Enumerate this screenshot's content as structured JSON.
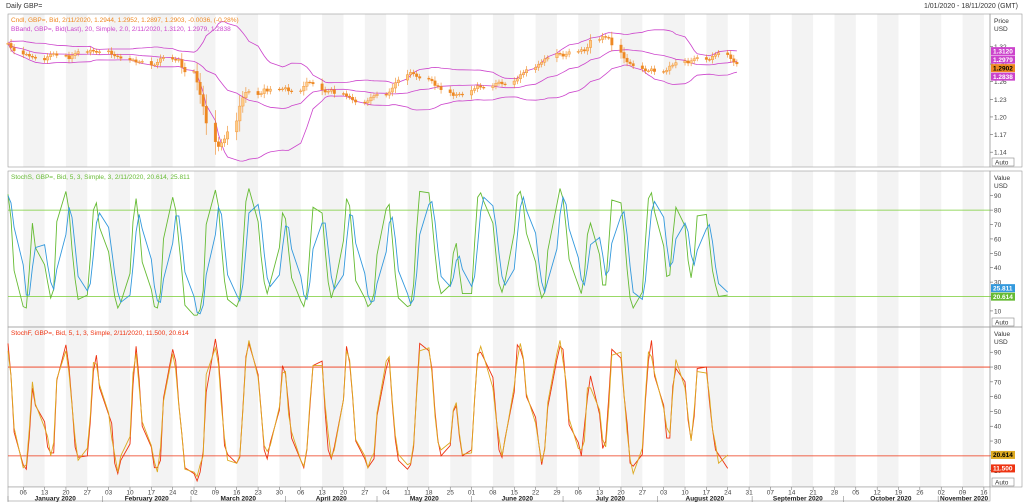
{
  "header": {
    "title": "Daily GBP=",
    "range": "1/01/2020 - 18/11/2020 (GMT)"
  },
  "colors": {
    "candle_up": "#ffcc88",
    "candle_down": "#ee8822",
    "bband": "#cc44cc",
    "stochs_k": "#66bb33",
    "stochs_d": "#3399dd",
    "stochf_k": "#ee3311",
    "stochf_d": "#ddaa22",
    "band_lines_mid": "#77cc33",
    "band_lines_bottom": "#ee3311",
    "shade": "#f3f3f3"
  },
  "panels": {
    "price": {
      "legend": [
        {
          "text": "Cndl, GBP=, Bid, 2/11/2020, 1.2944, 1.2952, 1.2897, 1.2903, -0.0036, (-0.28%)",
          "color": "#ee8822"
        },
        {
          "text": "BBand, GBP=, Bid(Last), 20, Simple, 2.0, 2/11/2020, 1.3120, 1.2979, 1.2838",
          "color": "#cc44cc"
        }
      ],
      "axis_title": [
        "Price",
        "USD"
      ],
      "auto_label": "Auto",
      "tags": [
        {
          "text": "1.3120",
          "bg": "#cc44cc",
          "fg": "#ffffff",
          "value": 1.312
        },
        {
          "text": "1.2979",
          "bg": "#cc44cc",
          "fg": "#ffffff",
          "value": 1.2979
        },
        {
          "text": "1.2902",
          "bg": "#ee8822",
          "fg": "#000000",
          "value": 1.2902
        },
        {
          "text": "1.2838",
          "bg": "#cc44cc",
          "fg": "#ffffff",
          "value": 1.2838
        }
      ]
    },
    "stochs": {
      "legend": [
        {
          "text": "StochS, GBP=, Bid, 5, 3, Simple, 3, 2/11/2020, 20.614, 25.811",
          "color": "#66bb33"
        }
      ],
      "legend_value2_color": "#3399dd",
      "axis_title": [
        "Value",
        "USD"
      ],
      "auto_label": "Auto",
      "tags": [
        {
          "text": "25.811",
          "bg": "#3399dd",
          "fg": "#ffffff",
          "value": 25.811
        },
        {
          "text": "20.614",
          "bg": "#66bb33",
          "fg": "#ffffff",
          "value": 20.614
        }
      ]
    },
    "stochf": {
      "legend": [
        {
          "text": "StochF, GBP=, Bid, 5, 1, 3, Simple, 2/11/2020, 11.500, 20.614",
          "color": "#ee3311"
        }
      ],
      "axis_title": [
        "Value",
        "USD"
      ],
      "auto_label": "Auto",
      "tags": [
        {
          "text": "20.614",
          "bg": "#ddaa22",
          "fg": "#000000",
          "value": 20.614
        },
        {
          "text": "11.500",
          "bg": "#ee3311",
          "fg": "#ffffff",
          "value": 11.5
        }
      ]
    }
  },
  "x_axis": {
    "months": [
      "January 2020",
      "February 2020",
      "March 2020",
      "April 2020",
      "May 2020",
      "June 2020",
      "July 2020",
      "August 2020",
      "September 2020",
      "October 2020",
      "November 2020"
    ],
    "days": [
      "06",
      "13",
      "20",
      "27",
      "03",
      "10",
      "17",
      "24",
      "02",
      "09",
      "16",
      "23",
      "30",
      "06",
      "13",
      "20",
      "27",
      "04",
      "11",
      "18",
      "25",
      "01",
      "08",
      "15",
      "22",
      "29",
      "06",
      "13",
      "20",
      "27",
      "03",
      "10",
      "17",
      "24",
      "31",
      "07",
      "14",
      "21",
      "28",
      "05",
      "12",
      "19",
      "26",
      "02",
      "09",
      "16"
    ]
  },
  "chart_data": [
    {
      "type": "candlestick",
      "title": "Cndl, GBP=, Bid",
      "ylabel": "Price USD",
      "ylim": [
        1.125,
        1.365
      ],
      "yticks": [
        1.14,
        1.17,
        1.2,
        1.23,
        1.26,
        1.29,
        1.32
      ],
      "x_start": "2020-01-01",
      "x_end": "2020-11-18",
      "close": [
        1.3252,
        1.3179,
        1.3128,
        1.3068,
        1.3068,
        1.3034,
        1.3018,
        1.2999,
        1.2969,
        1.3024,
        1.3066,
        1.3077,
        1.3048,
        1.3046,
        1.2989,
        1.3041,
        1.3081,
        1.3112,
        1.31,
        1.3138,
        1.3119,
        1.3099,
        1.3108,
        1.3123,
        1.3067,
        1.3038,
        1.3026,
        1.2998,
        1.2969,
        1.2972,
        1.2932,
        1.2937,
        1.2946,
        1.2883,
        1.2884,
        1.2931,
        1.2994,
        1.3013,
        1.2983,
        1.2964,
        1.2978,
        1.2846,
        1.2766,
        1.2776,
        1.2592,
        1.2381,
        1.2182,
        1.1896,
        1.1578,
        1.1496,
        1.1559,
        1.1625,
        1.1746,
        1.1932,
        1.2185,
        1.2326,
        1.2421,
        1.2435,
        1.2379,
        1.2398,
        1.2477,
        1.2437,
        1.2474,
        1.2468,
        1.2476,
        1.2498,
        1.2442,
        1.2431,
        1.2443,
        1.2523,
        1.2594,
        1.2588,
        1.2563,
        1.2462,
        1.2423,
        1.2439,
        1.2463,
        1.2398,
        1.2395,
        1.2355,
        1.2336,
        1.229,
        1.2253,
        1.2238,
        1.2274,
        1.2332,
        1.2362,
        1.2386,
        1.2371,
        1.2424,
        1.2492,
        1.2582,
        1.2628,
        1.2718,
        1.2758,
        1.2733,
        1.2687,
        1.2661,
        1.2643,
        1.2614,
        1.2535,
        1.2519,
        1.2462,
        1.2413,
        1.2363,
        1.2381,
        1.2389,
        1.2374,
        1.2451,
        1.2482,
        1.2531,
        1.2505,
        1.2498,
        1.2528,
        1.2573,
        1.2594,
        1.2561,
        1.2553,
        1.2611,
        1.2649,
        1.2719,
        1.2751,
        1.2804,
        1.2844,
        1.2895,
        1.2931,
        1.2987,
        1.3008,
        1.3082,
        1.3072,
        1.3033,
        1.3069,
        1.3108,
        1.3116,
        1.3145,
        1.3123,
        1.3182,
        1.3304,
        1.3318,
        1.337,
        1.3354,
        1.3346,
        1.3224,
        1.3098,
        1.3001,
        1.2935,
        1.2908,
        1.2869,
        1.2821,
        1.2784,
        1.2784,
        1.2818,
        1.2773,
        1.2767,
        1.2794,
        1.2866,
        1.2883,
        1.2924,
        1.2954,
        1.2917,
        1.2955,
        1.2991,
        1.3012,
        1.2978,
        1.2974,
        1.3033,
        1.3061,
        1.3091,
        1.3059,
        1.2991,
        1.2932,
        1.2903
      ]
    },
    {
      "type": "line",
      "title": "StochS, GBP=, Bid, 5, 3, Simple, 3",
      "ylabel": "Value USD",
      "ylim": [
        3,
        103
      ],
      "yticks": [
        10,
        20,
        30,
        40,
        50,
        60,
        70,
        80,
        90
      ],
      "reference_lines": [
        80,
        20
      ],
      "x_start": "2020-01-01",
      "x_end": "2020-11-18",
      "series": [
        {
          "name": "StochS %K",
          "values": [
            91,
            74,
            38,
            13,
            12,
            38,
            71,
            54,
            42,
            30,
            19,
            25,
            72,
            93,
            80,
            53,
            32,
            18,
            21,
            47,
            80,
            85,
            68,
            51,
            36,
            20,
            12,
            16,
            36,
            72,
            88,
            70,
            44,
            25,
            13,
            12,
            23,
            60,
            89,
            80,
            58,
            38,
            14,
            7,
            7,
            11,
            24,
            70,
            94,
            83,
            55,
            31,
            18,
            13,
            19,
            52,
            86,
            95,
            72,
            48,
            30,
            22,
            30,
            54,
            78,
            74,
            52,
            33,
            17,
            13,
            23,
            53,
            82,
            78,
            52,
            30,
            19,
            26,
            59,
            88,
            83,
            58,
            31,
            19,
            13,
            15,
            22,
            49,
            81,
            84,
            60,
            35,
            19,
            13,
            14,
            28,
            67,
            93,
            92,
            74,
            50,
            31,
            22,
            28,
            50,
            57,
            37,
            22,
            22,
            57,
            89,
            92,
            86,
            71,
            49,
            29,
            23,
            31,
            64,
            90,
            93,
            83,
            64,
            44,
            28,
            19,
            23,
            52,
            84,
            95,
            88,
            68,
            46,
            28,
            22,
            35,
            63,
            71,
            49,
            28,
            28,
            57,
            87,
            85,
            65,
            39,
            19,
            12,
            23,
            58,
            88,
            92,
            79,
            55,
            34,
            35,
            62,
            82,
            69,
            45,
            33,
            48,
            76,
            77,
            58,
            38,
            28,
            20,
            21
          ]
        },
        {
          "name": "StochS %D",
          "values": [
            90,
            85,
            68,
            42,
            21,
            21,
            40,
            54,
            56,
            42,
            30,
            25,
            39,
            63,
            82,
            75,
            55,
            34,
            24,
            29,
            49,
            71,
            78,
            68,
            52,
            36,
            23,
            16,
            21,
            41,
            65,
            77,
            67,
            46,
            27,
            17,
            16,
            32,
            57,
            76,
            76,
            59,
            37,
            20,
            9,
            8,
            14,
            35,
            63,
            82,
            77,
            56,
            35,
            21,
            17,
            28,
            52,
            78,
            84,
            72,
            50,
            33,
            27,
            35,
            54,
            69,
            68,
            53,
            34,
            21,
            18,
            30,
            53,
            71,
            71,
            53,
            34,
            25,
            35,
            58,
            77,
            76,
            57,
            36,
            21,
            16,
            17,
            29,
            51,
            71,
            75,
            60,
            38,
            22,
            15,
            18,
            36,
            63,
            84,
            86,
            72,
            52,
            34,
            27,
            33,
            45,
            48,
            39,
            27,
            34,
            56,
            79,
            89,
            83,
            69,
            50,
            34,
            28,
            39,
            62,
            82,
            89,
            80,
            64,
            45,
            30,
            23,
            31,
            53,
            77,
            89,
            84,
            67,
            47,
            32,
            28,
            40,
            56,
            61,
            49,
            35,
            38,
            57,
            76,
            79,
            63,
            41,
            23,
            18,
            31,
            56,
            79,
            86,
            75,
            56,
            41,
            44,
            60,
            71,
            65,
            49,
            42,
            52,
            67,
            70,
            58,
            41,
            29,
            23
          ]
        }
      ]
    },
    {
      "type": "line",
      "title": "StochF, GBP=, Bid, 5, 1, 3, Simple",
      "ylabel": "Value USD",
      "ylim": [
        3,
        103
      ],
      "yticks": [
        10,
        20,
        30,
        40,
        50,
        60,
        70,
        80,
        90
      ],
      "reference_lines": [
        80,
        20
      ],
      "x_start": "2020-01-01",
      "x_end": "2020-11-18",
      "series": [
        {
          "name": "StochF %K",
          "values": [
            96,
            74,
            36,
            14,
            11,
            33,
            66,
            54,
            43,
            26,
            22,
            22,
            71,
            95,
            80,
            55,
            26,
            19,
            20,
            43,
            77,
            88,
            66,
            48,
            42,
            15,
            8,
            17,
            28,
            68,
            94,
            72,
            40,
            26,
            12,
            12,
            17,
            59,
            92,
            84,
            55,
            35,
            12,
            8,
            3,
            9,
            23,
            63,
            99,
            86,
            59,
            27,
            21,
            15,
            19,
            51,
            87,
            96,
            75,
            51,
            24,
            18,
            29,
            51,
            81,
            75,
            54,
            32,
            17,
            12,
            24,
            53,
            81,
            84,
            49,
            24,
            18,
            26,
            58,
            94,
            83,
            60,
            30,
            18,
            12,
            15,
            18,
            47,
            79,
            86,
            55,
            31,
            17,
            11,
            14,
            26,
            64,
            96,
            91,
            79,
            50,
            30,
            20,
            27,
            50,
            54,
            33,
            20,
            24,
            58,
            89,
            90,
            86,
            73,
            48,
            24,
            19,
            32,
            63,
            95,
            92,
            85,
            60,
            46,
            29,
            14,
            25,
            53,
            85,
            94,
            92,
            66,
            41,
            29,
            20,
            40,
            59,
            74,
            48,
            25,
            30,
            60,
            92,
            86,
            61,
            42,
            15,
            13,
            21,
            57,
            84,
            98,
            74,
            54,
            32,
            32,
            67,
            79,
            70,
            44,
            31,
            47,
            79,
            80,
            57,
            38,
            24,
            21,
            11.5
          ]
        },
        {
          "name": "StochF %D",
          "values": [
            91,
            74,
            39,
            12,
            14,
            38,
            70,
            55,
            39,
            33,
            20,
            29,
            72,
            91,
            76,
            54,
            32,
            17,
            25,
            47,
            83,
            82,
            68,
            49,
            32,
            21,
            9,
            20,
            33,
            76,
            89,
            67,
            43,
            27,
            16,
            9,
            26,
            57,
            89,
            78,
            54,
            35,
            11,
            9,
            6,
            14,
            20,
            75,
            93,
            82,
            53,
            32,
            17,
            15,
            20,
            50,
            85,
            98,
            73,
            50,
            27,
            23,
            27,
            53,
            76,
            77,
            48,
            36,
            17,
            13,
            25,
            56,
            81,
            81,
            54,
            35,
            19,
            24,
            58,
            91,
            85,
            61,
            31,
            20,
            12,
            18,
            22,
            49,
            84,
            87,
            57,
            34,
            21,
            14,
            15,
            28,
            62,
            91,
            93,
            76,
            47,
            29,
            24,
            29,
            51,
            56,
            35,
            21,
            22,
            59,
            87,
            94,
            87,
            66,
            46,
            32,
            20,
            31,
            67,
            85,
            96,
            86,
            62,
            42,
            29,
            16,
            24,
            56,
            89,
            98,
            84,
            70,
            45,
            25,
            24,
            30,
            66,
            66,
            51,
            31,
            26,
            53,
            88,
            90,
            62,
            36,
            18,
            8,
            25,
            61,
            90,
            87,
            76,
            52,
            39,
            35,
            63,
            85,
            66,
            47,
            30,
            51,
            77,
            76,
            61,
            38,
            28,
            15,
            20.614
          ]
        }
      ]
    }
  ]
}
